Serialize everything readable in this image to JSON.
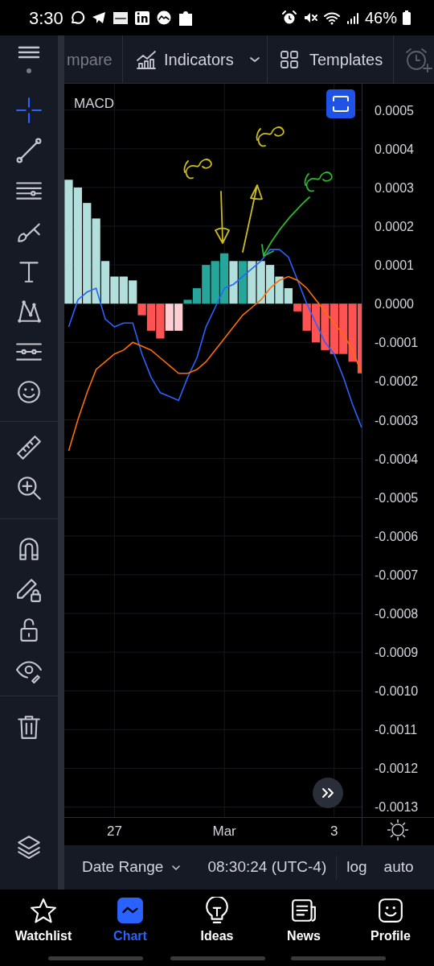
{
  "status_bar": {
    "time": "3:30",
    "battery": "46%"
  },
  "toolbar": {
    "compare_label": "mpare",
    "indicators_label": "Indicators",
    "templates_label": "Templates"
  },
  "tool_groups": [
    {
      "tools": [
        {
          "kind": "crosshair",
          "selected": true
        },
        {
          "kind": "trend-line",
          "selected": false
        },
        {
          "kind": "fib",
          "selected": false
        },
        {
          "kind": "brush",
          "selected": false
        },
        {
          "kind": "text",
          "selected": false
        },
        {
          "kind": "pattern",
          "selected": false
        },
        {
          "kind": "prediction",
          "selected": false
        },
        {
          "kind": "emoji",
          "selected": false
        }
      ]
    },
    {
      "tools": [
        {
          "kind": "ruler",
          "selected": false
        },
        {
          "kind": "zoom-in",
          "selected": false
        }
      ]
    },
    {
      "tools": [
        {
          "kind": "magnet",
          "selected": false
        },
        {
          "kind": "pencil-lock",
          "selected": false
        },
        {
          "kind": "lock",
          "selected": false
        },
        {
          "kind": "eye",
          "selected": false
        }
      ]
    },
    {
      "tools": [
        {
          "kind": "trash",
          "selected": false
        }
      ]
    }
  ],
  "chart": {
    "chart_data": {
      "type": "bar",
      "title": "MACD",
      "grid": true,
      "categories": [
        null,
        null,
        null,
        null,
        null,
        "27",
        null,
        null,
        null,
        null,
        null,
        null,
        null,
        null,
        null,
        null,
        null,
        "Mar",
        null,
        null,
        null,
        null,
        null,
        null,
        null,
        null,
        null,
        null,
        null,
        "3",
        null,
        null,
        null
      ],
      "ylim": [
        -0.001326,
        0.000568
      ],
      "yticks": [
        {
          "value": 0.0005,
          "label": "0.0005"
        },
        {
          "value": 0.0004,
          "label": "0.0004"
        },
        {
          "value": 0.0003,
          "label": "0.0003"
        },
        {
          "value": 0.0002,
          "label": "0.0002"
        },
        {
          "value": 0.0001,
          "label": "0.0001"
        },
        {
          "value": 0,
          "label": "0.0000"
        },
        {
          "value": -0.0001,
          "label": "-0.0001"
        },
        {
          "value": -0.0002,
          "label": "-0.0002"
        },
        {
          "value": -0.0003,
          "label": "-0.0003"
        },
        {
          "value": -0.0004,
          "label": "-0.0004"
        },
        {
          "value": -0.0005,
          "label": "-0.0005"
        },
        {
          "value": -0.0006,
          "label": "-0.0006"
        },
        {
          "value": -0.0007,
          "label": "-0.0007"
        },
        {
          "value": -0.0008,
          "label": "-0.0008"
        },
        {
          "value": -0.0009,
          "label": "-0.0009"
        },
        {
          "value": -0.001,
          "label": "-0.0010"
        },
        {
          "value": -0.0011,
          "label": "-0.0011"
        },
        {
          "value": -0.0012,
          "label": "-0.0012"
        },
        {
          "value": -0.0013,
          "label": "-0.0013"
        }
      ],
      "series": [
        {
          "color": "#b2dfdb",
          "values": [
            0.00032,
            0.0003,
            0.00026,
            0.00022,
            0.00011,
            7e-05,
            7e-05,
            6e-05,
            null,
            null,
            null,
            null,
            null,
            null,
            null,
            null,
            null,
            null,
            0.00011,
            null,
            0.00011,
            0.00011,
            0.0001,
            7e-05,
            4e-05,
            null,
            null,
            null,
            null,
            null,
            null,
            null,
            null
          ]
        },
        {
          "color": "#ff5252",
          "values": [
            null,
            null,
            null,
            null,
            null,
            null,
            null,
            null,
            -3e-05,
            -7e-05,
            -9e-05,
            null,
            null,
            null,
            null,
            null,
            null,
            null,
            null,
            null,
            null,
            null,
            null,
            null,
            null,
            -2e-05,
            -7e-05,
            -0.0001,
            -0.00012,
            -0.00013,
            -0.00013,
            -0.00015,
            -0.00018
          ]
        },
        {
          "color": "#ffcdd2",
          "values": [
            null,
            null,
            null,
            null,
            null,
            null,
            null,
            null,
            null,
            null,
            null,
            -7e-05,
            -7e-05,
            null,
            null,
            null,
            null,
            null,
            null,
            null,
            null,
            null,
            null,
            null,
            null,
            null,
            null,
            null,
            null,
            null,
            null,
            null,
            null
          ]
        },
        {
          "color": "#26a69a",
          "values": [
            null,
            null,
            null,
            null,
            null,
            null,
            null,
            null,
            null,
            null,
            null,
            null,
            null,
            1e-05,
            4e-05,
            0.0001,
            0.00011,
            0.00013,
            null,
            0.00011,
            null,
            null,
            null,
            null,
            null,
            null,
            null,
            null,
            null,
            null,
            null,
            null,
            null
          ]
        },
        {
          "type": "line",
          "color": "#2962ff",
          "values": [
            -6e-05,
            1e-05,
            3e-05,
            4e-05,
            -4e-05,
            -6e-05,
            -5e-05,
            -5e-05,
            -0.00013,
            -0.00019,
            -0.00023,
            -0.00024,
            -0.00025,
            -0.00019,
            -0.00014,
            -6e-05,
            -1e-05,
            4e-05,
            5e-05,
            7e-05,
            9e-05,
            0.00011,
            0.00014,
            0.00014,
            0.00012,
            6e-05,
            0,
            -5e-05,
            -0.0001,
            -0.00013,
            -0.00019,
            -0.00026,
            -0.00032
          ]
        },
        {
          "type": "line",
          "color": "#ff6d00",
          "values": [
            -0.00038,
            -0.0003,
            -0.00023,
            -0.00017,
            -0.00015,
            -0.00013,
            -0.00012,
            -0.0001,
            -0.00011,
            -0.00012,
            -0.00014,
            -0.00016,
            -0.00018,
            -0.00018,
            -0.00017,
            -0.00015,
            -0.00012,
            -9e-05,
            -6e-05,
            -3e-05,
            -1e-05,
            1e-05,
            4e-05,
            6e-05,
            7e-05,
            6e-05,
            4e-05,
            1e-05,
            -2e-05,
            -5e-05,
            -8e-05,
            -0.00012,
            -0.00018
          ]
        }
      ]
    },
    "drawings": [
      {
        "kind": "scribble",
        "color": "#cbbd1c"
      },
      {
        "kind": "arrow-down",
        "color": "#cbbd1c"
      },
      {
        "kind": "arrow-up",
        "color": "#cbbd1c"
      },
      {
        "kind": "scribble",
        "color": "#cbbd1c"
      },
      {
        "kind": "curved-arrow",
        "color": "#2fb52f"
      },
      {
        "kind": "scribble",
        "color": "#2fb52f"
      }
    ]
  },
  "bottom_bar": {
    "date_range": "Date Range",
    "time": "08:30:24 (UTC-4)",
    "log": "log",
    "auto": "auto"
  },
  "nav": [
    {
      "label": "Watchlist",
      "kind": "star",
      "selected": false
    },
    {
      "label": "Chart",
      "kind": "chart",
      "selected": true
    },
    {
      "label": "Ideas",
      "kind": "bulb",
      "selected": false
    },
    {
      "label": "News",
      "kind": "news",
      "selected": false
    },
    {
      "label": "Profile",
      "kind": "smile",
      "selected": false
    }
  ]
}
